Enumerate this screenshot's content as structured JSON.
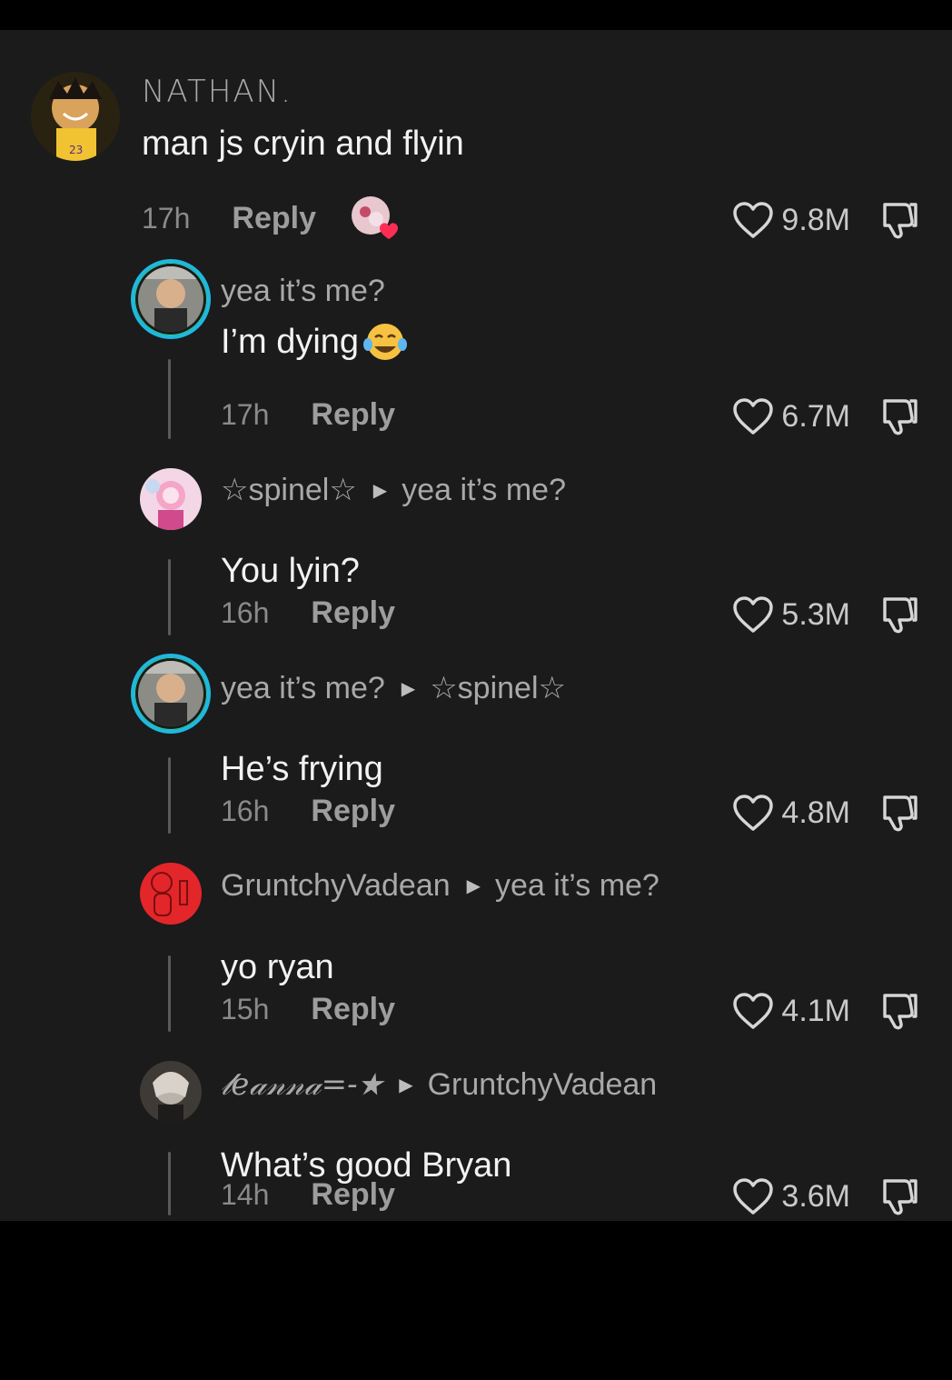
{
  "comments": [
    {
      "username": "NATHAN.",
      "text": "man js cryin and flyin",
      "time": "17h",
      "reply_label": "Reply",
      "likes": "9.8M",
      "avatar_color": "#4b3a1f"
    },
    {
      "username": "yea it’s me?",
      "text": "I’m dying",
      "time": "17h",
      "reply_label": "Reply",
      "likes": "6.7M"
    },
    {
      "username": "☆spinel☆",
      "reply_to": "yea it’s me?",
      "text": "You lyin?",
      "time": "16h",
      "reply_label": "Reply",
      "likes": "5.3M"
    },
    {
      "username": "yea it’s me?",
      "reply_to": "☆spinel☆",
      "text": "He’s frying",
      "time": "16h",
      "reply_label": "Reply",
      "likes": "4.8M"
    },
    {
      "username": "GruntchyVadean",
      "reply_to": "yea it’s me?",
      "text": "yo ryan",
      "time": "15h",
      "reply_label": "Reply",
      "likes": "4.1M"
    },
    {
      "username": "𝓁𝑒𝒶𝓃𝓃𝒶=-★",
      "reply_to": "GruntchyVadean",
      "text": "What’s good Bryan",
      "time": "14h",
      "reply_label": "Reply",
      "likes": "3.6M"
    }
  ],
  "icons": {
    "like": "heart-outline-icon",
    "dislike": "thumbs-down-icon",
    "reply_arrow": "triangle-right-icon",
    "laugh_emoji": "tears-of-joy-emoji"
  },
  "colors": {
    "background": "#1b1b1b",
    "story_ring": "#1fb8e0",
    "liked_heart": "#ff2d55"
  }
}
